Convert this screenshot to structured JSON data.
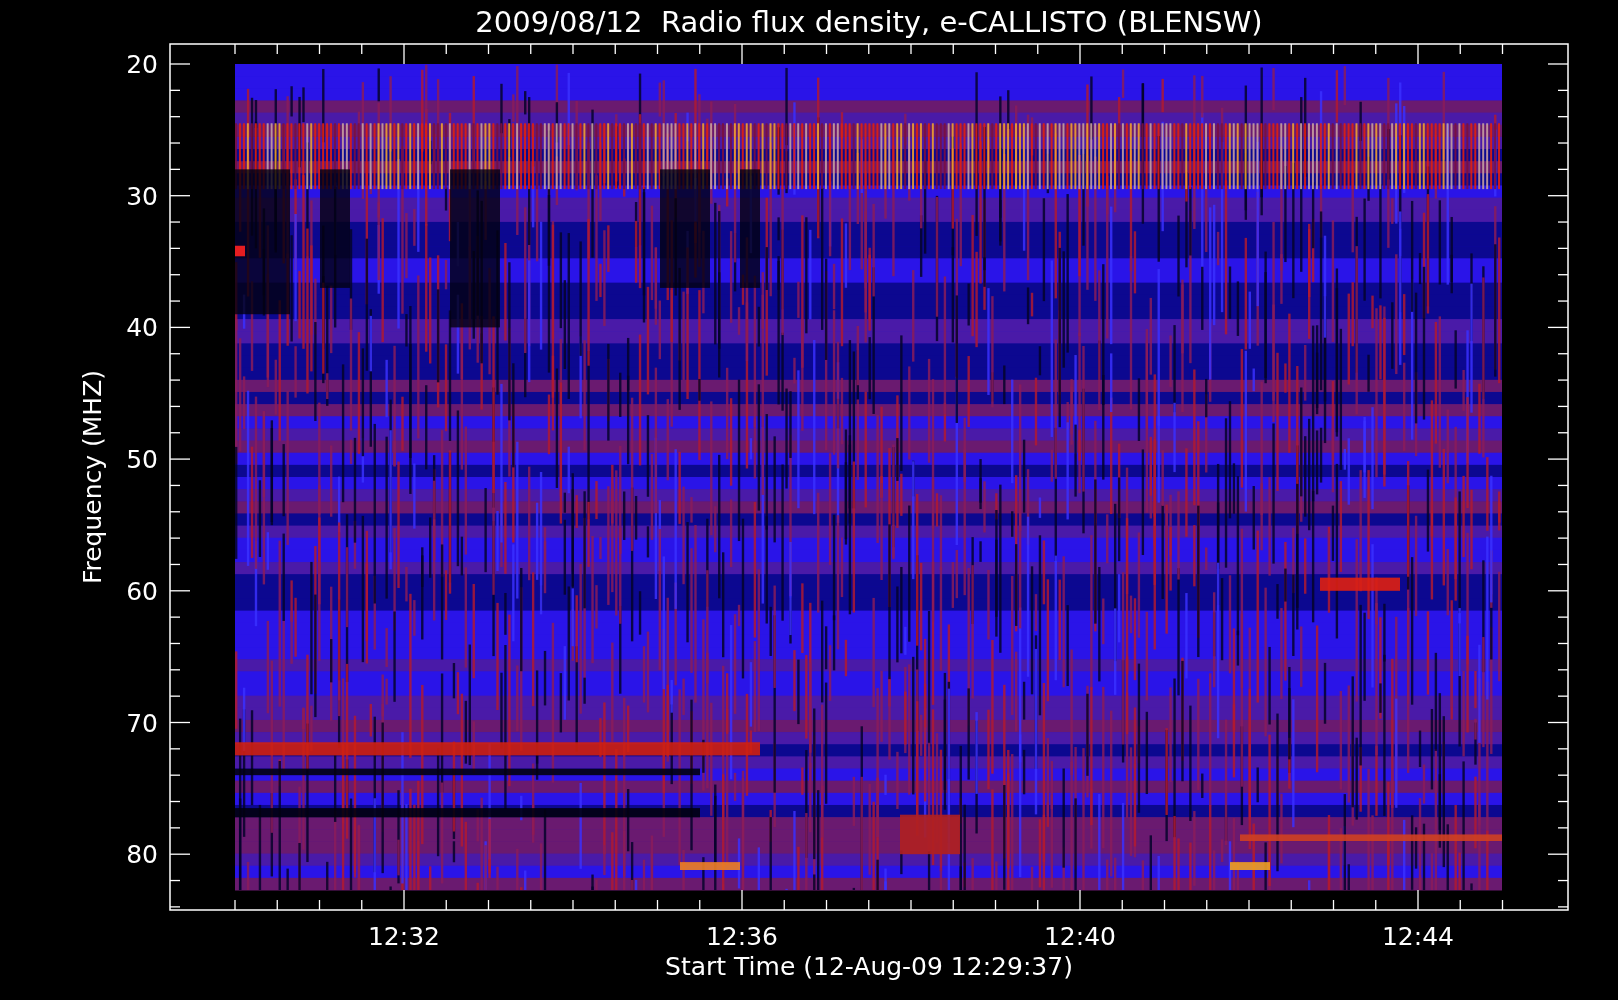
{
  "title": "2009/08/12  Radio flux density, e-CALLISTO (BLENSW)",
  "y_axis": {
    "label": "Frequency (MHZ)",
    "ticks": [
      "20",
      "30",
      "40",
      "50",
      "60",
      "70",
      "80"
    ]
  },
  "x_axis": {
    "label": "Start Time (12-Aug-09 12:29:37)",
    "ticks": [
      "12:32",
      "12:36",
      "12:40",
      "12:44"
    ]
  }
}
